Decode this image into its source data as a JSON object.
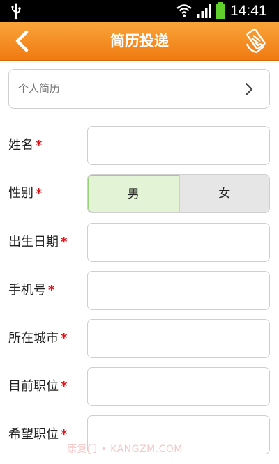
{
  "status_bar": {
    "time": "14:41",
    "icons": [
      "usb-icon",
      "wifi-icon",
      "signal-icon",
      "battery-icon"
    ],
    "battery_color": "#5fd02b"
  },
  "title_bar": {
    "title": "简历投递",
    "back_icon": "chevron-left-icon",
    "action_icon": "send-resume-icon",
    "color": "#f39020"
  },
  "resume_selector": {
    "label": "个人简历",
    "icon": "chevron-right-icon"
  },
  "form": {
    "required_mark": "*",
    "required_color": "#e0141b",
    "fields": [
      {
        "label": "姓名",
        "value": ""
      },
      {
        "label": "性别",
        "options": [
          "男",
          "女"
        ],
        "selected": "男"
      },
      {
        "label": "出生日期",
        "value": ""
      },
      {
        "label": "手机号",
        "value": ""
      },
      {
        "label": "所在城市",
        "value": ""
      },
      {
        "label": "目前职位",
        "value": ""
      },
      {
        "label": "希望职位",
        "value": ""
      }
    ]
  },
  "watermark": "康复门 • KANGZM.COM"
}
